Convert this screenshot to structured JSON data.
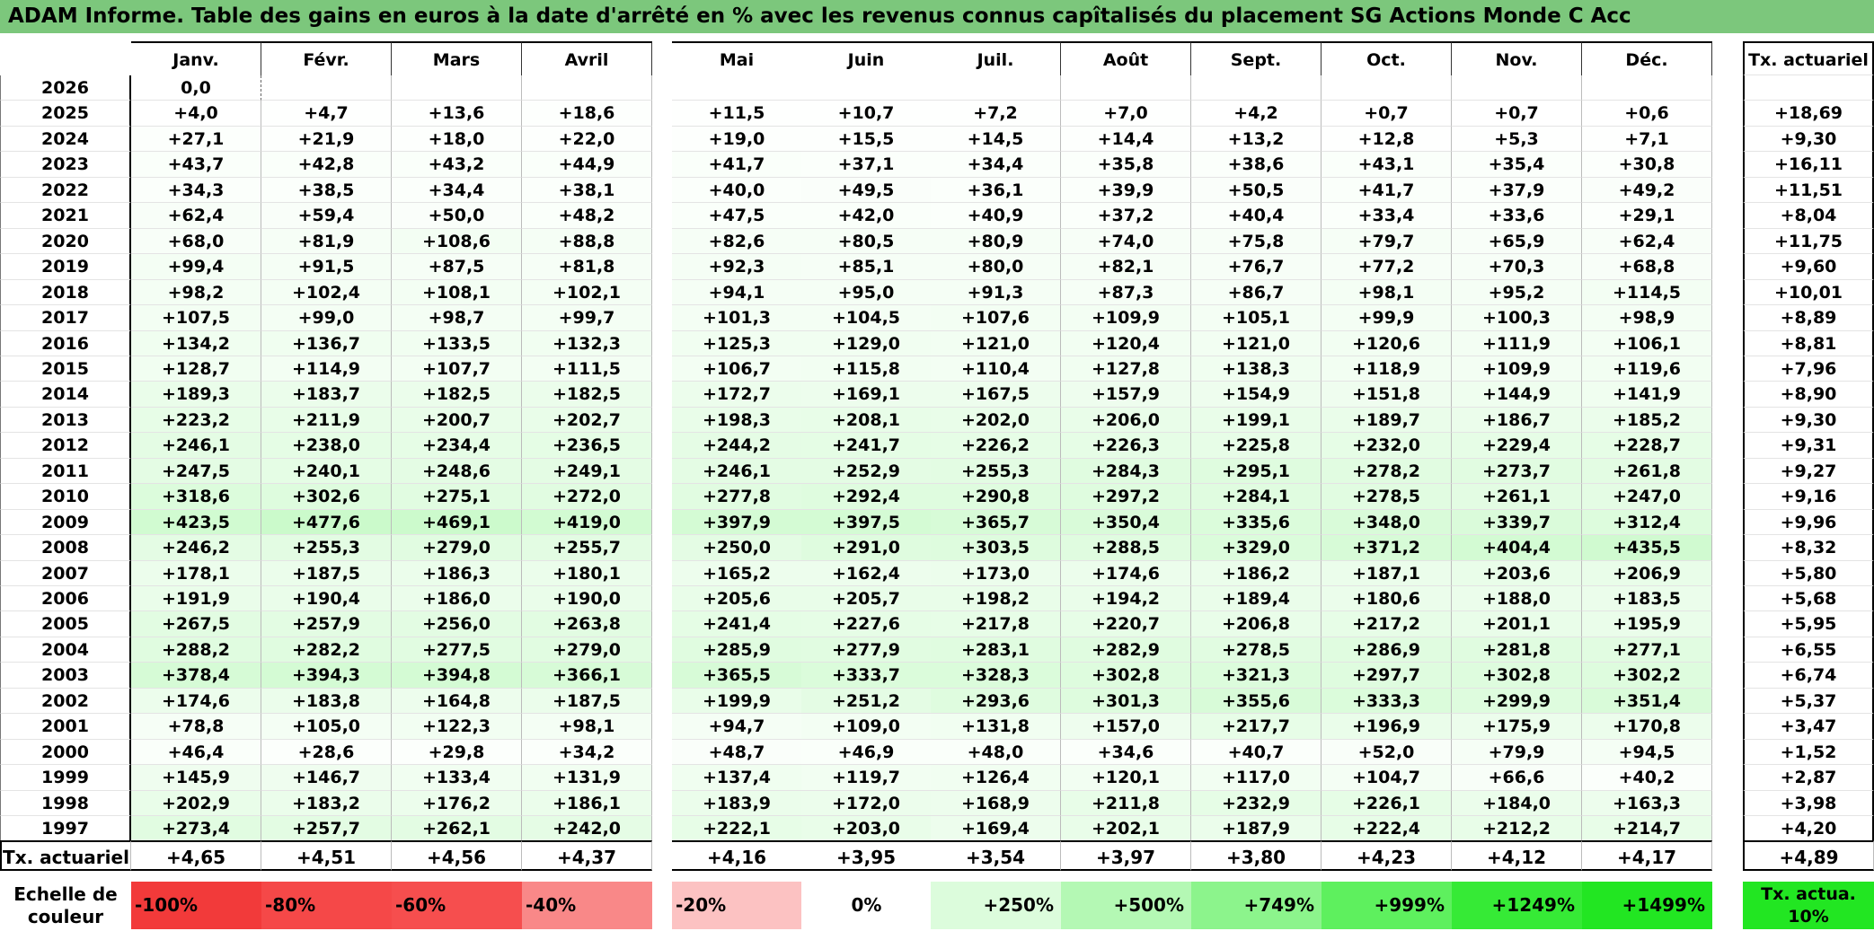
{
  "title": "ADAM Informe. Table des gains en euros à la date d'arrêté en % avec les revenus connus capîtalisés du placement SG Actions Monde C Acc",
  "months": [
    "Janv.",
    "Févr.",
    "Mars",
    "Avril",
    "Mai",
    "Juin",
    "Juil.",
    "Août",
    "Sept.",
    "Oct.",
    "Nov.",
    "Déc."
  ],
  "actuarial_header": "Tx. actuariel",
  "rows": [
    {
      "year": "2026",
      "values": [
        "0,0",
        "",
        "",
        "",
        "",
        "",
        "",
        "",
        "",
        "",
        "",
        ""
      ],
      "rate": ""
    },
    {
      "year": "2025",
      "values": [
        "+4,0",
        "+4,7",
        "+13,6",
        "+18,6",
        "+11,5",
        "+10,7",
        "+7,2",
        "+7,0",
        "+4,2",
        "+0,7",
        "+0,7",
        "+0,6"
      ],
      "rate": "+18,69"
    },
    {
      "year": "2024",
      "values": [
        "+27,1",
        "+21,9",
        "+18,0",
        "+22,0",
        "+19,0",
        "+15,5",
        "+14,5",
        "+14,4",
        "+13,2",
        "+12,8",
        "+5,3",
        "+7,1"
      ],
      "rate": "+9,30"
    },
    {
      "year": "2023",
      "values": [
        "+43,7",
        "+42,8",
        "+43,2",
        "+44,9",
        "+41,7",
        "+37,1",
        "+34,4",
        "+35,8",
        "+38,6",
        "+43,1",
        "+35,4",
        "+30,8"
      ],
      "rate": "+16,11"
    },
    {
      "year": "2022",
      "values": [
        "+34,3",
        "+38,5",
        "+34,4",
        "+38,1",
        "+40,0",
        "+49,5",
        "+36,1",
        "+39,9",
        "+50,5",
        "+41,7",
        "+37,9",
        "+49,2"
      ],
      "rate": "+11,51"
    },
    {
      "year": "2021",
      "values": [
        "+62,4",
        "+59,4",
        "+50,0",
        "+48,2",
        "+47,5",
        "+42,0",
        "+40,9",
        "+37,2",
        "+40,4",
        "+33,4",
        "+33,6",
        "+29,1"
      ],
      "rate": "+8,04"
    },
    {
      "year": "2020",
      "values": [
        "+68,0",
        "+81,9",
        "+108,6",
        "+88,8",
        "+82,6",
        "+80,5",
        "+80,9",
        "+74,0",
        "+75,8",
        "+79,7",
        "+65,9",
        "+62,4"
      ],
      "rate": "+11,75"
    },
    {
      "year": "2019",
      "values": [
        "+99,4",
        "+91,5",
        "+87,5",
        "+81,8",
        "+92,3",
        "+85,1",
        "+80,0",
        "+82,1",
        "+76,7",
        "+77,2",
        "+70,3",
        "+68,8"
      ],
      "rate": "+9,60"
    },
    {
      "year": "2018",
      "values": [
        "+98,2",
        "+102,4",
        "+108,1",
        "+102,1",
        "+94,1",
        "+95,0",
        "+91,3",
        "+87,3",
        "+86,7",
        "+98,1",
        "+95,2",
        "+114,5"
      ],
      "rate": "+10,01"
    },
    {
      "year": "2017",
      "values": [
        "+107,5",
        "+99,0",
        "+98,7",
        "+99,7",
        "+101,3",
        "+104,5",
        "+107,6",
        "+109,9",
        "+105,1",
        "+99,9",
        "+100,3",
        "+98,9"
      ],
      "rate": "+8,89"
    },
    {
      "year": "2016",
      "values": [
        "+134,2",
        "+136,7",
        "+133,5",
        "+132,3",
        "+125,3",
        "+129,0",
        "+121,0",
        "+120,4",
        "+121,0",
        "+120,6",
        "+111,9",
        "+106,1"
      ],
      "rate": "+8,81"
    },
    {
      "year": "2015",
      "values": [
        "+128,7",
        "+114,9",
        "+107,7",
        "+111,5",
        "+106,7",
        "+115,8",
        "+110,4",
        "+127,8",
        "+138,3",
        "+118,9",
        "+109,9",
        "+119,6"
      ],
      "rate": "+7,96"
    },
    {
      "year": "2014",
      "values": [
        "+189,3",
        "+183,7",
        "+182,5",
        "+182,5",
        "+172,7",
        "+169,1",
        "+167,5",
        "+157,9",
        "+154,9",
        "+151,8",
        "+144,9",
        "+141,9"
      ],
      "rate": "+8,90"
    },
    {
      "year": "2013",
      "values": [
        "+223,2",
        "+211,9",
        "+200,7",
        "+202,7",
        "+198,3",
        "+208,1",
        "+202,0",
        "+206,0",
        "+199,1",
        "+189,7",
        "+186,7",
        "+185,2"
      ],
      "rate": "+9,30"
    },
    {
      "year": "2012",
      "values": [
        "+246,1",
        "+238,0",
        "+234,4",
        "+236,5",
        "+244,2",
        "+241,7",
        "+226,2",
        "+226,3",
        "+225,8",
        "+232,0",
        "+229,4",
        "+228,7"
      ],
      "rate": "+9,31"
    },
    {
      "year": "2011",
      "values": [
        "+247,5",
        "+240,1",
        "+248,6",
        "+249,1",
        "+246,1",
        "+252,9",
        "+255,3",
        "+284,3",
        "+295,1",
        "+278,2",
        "+273,7",
        "+261,8"
      ],
      "rate": "+9,27"
    },
    {
      "year": "2010",
      "values": [
        "+318,6",
        "+302,6",
        "+275,1",
        "+272,0",
        "+277,8",
        "+292,4",
        "+290,8",
        "+297,2",
        "+284,1",
        "+278,5",
        "+261,1",
        "+247,0"
      ],
      "rate": "+9,16"
    },
    {
      "year": "2009",
      "values": [
        "+423,5",
        "+477,6",
        "+469,1",
        "+419,0",
        "+397,9",
        "+397,5",
        "+365,7",
        "+350,4",
        "+335,6",
        "+348,0",
        "+339,7",
        "+312,4"
      ],
      "rate": "+9,96"
    },
    {
      "year": "2008",
      "values": [
        "+246,2",
        "+255,3",
        "+279,0",
        "+255,7",
        "+250,0",
        "+291,0",
        "+303,5",
        "+288,5",
        "+329,0",
        "+371,2",
        "+404,4",
        "+435,5"
      ],
      "rate": "+8,32"
    },
    {
      "year": "2007",
      "values": [
        "+178,1",
        "+187,5",
        "+186,3",
        "+180,1",
        "+165,2",
        "+162,4",
        "+173,0",
        "+174,6",
        "+186,2",
        "+187,1",
        "+203,6",
        "+206,9"
      ],
      "rate": "+5,80"
    },
    {
      "year": "2006",
      "values": [
        "+191,9",
        "+190,4",
        "+186,0",
        "+190,0",
        "+205,6",
        "+205,7",
        "+198,2",
        "+194,2",
        "+189,4",
        "+180,6",
        "+188,0",
        "+183,5"
      ],
      "rate": "+5,68"
    },
    {
      "year": "2005",
      "values": [
        "+267,5",
        "+257,9",
        "+256,0",
        "+263,8",
        "+241,4",
        "+227,6",
        "+217,8",
        "+220,7",
        "+206,8",
        "+217,2",
        "+201,1",
        "+195,9"
      ],
      "rate": "+5,95"
    },
    {
      "year": "2004",
      "values": [
        "+288,2",
        "+282,2",
        "+277,5",
        "+279,0",
        "+285,9",
        "+277,9",
        "+283,1",
        "+282,9",
        "+278,5",
        "+286,9",
        "+281,8",
        "+277,1"
      ],
      "rate": "+6,55"
    },
    {
      "year": "2003",
      "values": [
        "+378,4",
        "+394,3",
        "+394,8",
        "+366,1",
        "+365,5",
        "+333,7",
        "+328,3",
        "+302,8",
        "+321,3",
        "+297,7",
        "+302,8",
        "+302,2"
      ],
      "rate": "+6,74"
    },
    {
      "year": "2002",
      "values": [
        "+174,6",
        "+183,8",
        "+164,8",
        "+187,5",
        "+199,9",
        "+251,2",
        "+293,6",
        "+301,3",
        "+355,6",
        "+333,3",
        "+299,9",
        "+351,4"
      ],
      "rate": "+5,37"
    },
    {
      "year": "2001",
      "values": [
        "+78,8",
        "+105,0",
        "+122,3",
        "+98,1",
        "+94,7",
        "+109,0",
        "+131,8",
        "+157,0",
        "+217,7",
        "+196,9",
        "+175,9",
        "+170,8"
      ],
      "rate": "+3,47"
    },
    {
      "year": "2000",
      "values": [
        "+46,4",
        "+28,6",
        "+29,8",
        "+34,2",
        "+48,7",
        "+46,9",
        "+48,0",
        "+34,6",
        "+40,7",
        "+52,0",
        "+79,9",
        "+94,5"
      ],
      "rate": "+1,52"
    },
    {
      "year": "1999",
      "values": [
        "+145,9",
        "+146,7",
        "+133,4",
        "+131,9",
        "+137,4",
        "+119,7",
        "+126,4",
        "+120,1",
        "+117,0",
        "+104,7",
        "+66,6",
        "+40,2"
      ],
      "rate": "+2,87"
    },
    {
      "year": "1998",
      "values": [
        "+202,9",
        "+183,2",
        "+176,2",
        "+186,1",
        "+183,9",
        "+172,0",
        "+168,9",
        "+211,8",
        "+232,9",
        "+226,1",
        "+184,0",
        "+163,3"
      ],
      "rate": "+3,98"
    },
    {
      "year": "1997",
      "values": [
        "+273,4",
        "+257,7",
        "+262,1",
        "+242,0",
        "+222,1",
        "+203,0",
        "+169,4",
        "+202,1",
        "+187,9",
        "+222,4",
        "+212,2",
        "+214,7"
      ],
      "rate": "+4,20"
    }
  ],
  "totals": {
    "label": "Tx. actuariel",
    "values": [
      "+4,65",
      "+4,51",
      "+4,56",
      "+4,37",
      "+4,16",
      "+3,95",
      "+3,54",
      "+3,97",
      "+3,80",
      "+4,23",
      "+4,12",
      "+4,17"
    ],
    "rate": "+4,89"
  },
  "legend": {
    "label": "Echelle de couleur",
    "items": [
      {
        "text": "-100%",
        "color": "#f23a3a",
        "kind": "neg"
      },
      {
        "text": "-80%",
        "color": "#f54848",
        "kind": "neg"
      },
      {
        "text": "-60%",
        "color": "#f64e4e",
        "kind": "neg"
      },
      {
        "text": "-40%",
        "color": "#f98888",
        "kind": "neg"
      },
      {
        "text": "-20%",
        "color": "#fcc2c2",
        "kind": "neg"
      },
      {
        "text": "0%",
        "color": "#ffffff",
        "kind": "zero"
      },
      {
        "text": "+250%",
        "color": "#dcfcdc",
        "kind": "pos"
      },
      {
        "text": "+500%",
        "color": "#b4f8b4",
        "kind": "pos"
      },
      {
        "text": "+749%",
        "color": "#8cf48c",
        "kind": "pos"
      },
      {
        "text": "+999%",
        "color": "#5ef05e",
        "kind": "pos"
      },
      {
        "text": "+1249%",
        "color": "#36ea36",
        "kind": "pos"
      },
      {
        "text": "+1499%",
        "color": "#22e622",
        "kind": "pos"
      }
    ],
    "rate_text": "Tx. actua. 10%",
    "rate_color": "#22e622"
  }
}
